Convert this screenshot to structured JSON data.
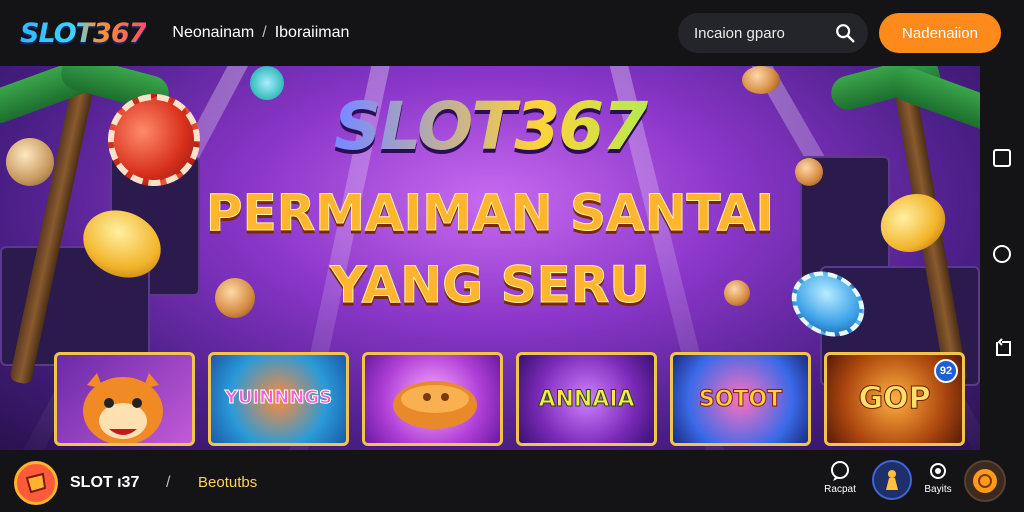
{
  "header": {
    "logo_text": "SLOT367",
    "nav_items": [
      "Neonainam",
      "Iboraiiman"
    ],
    "nav_separator": "/",
    "search_placeholder": "Incaion gparo",
    "cta_label": "Nadenaiion"
  },
  "banner": {
    "brand_title": "SLOT367",
    "headline_1": "PERMAIMAN SANTAI",
    "headline_2": "YANG SERU",
    "tiles": [
      {
        "label": "",
        "theme": "tiger"
      },
      {
        "label": "YUINNNGS",
        "theme": "blue"
      },
      {
        "label": "",
        "theme": "blob"
      },
      {
        "label": "ANNAIA",
        "theme": "purple"
      },
      {
        "label": "SOTOT",
        "theme": "blue-pink"
      },
      {
        "label": "GOP",
        "theme": "orange",
        "badge": "92"
      }
    ]
  },
  "rail": {
    "buttons": [
      "square-icon",
      "circle-icon",
      "back-icon"
    ]
  },
  "footer": {
    "brand": "SLOT ı37",
    "separator": "/",
    "link": "Beotutbs",
    "icons": [
      {
        "name": "chat-icon",
        "label": "Racpat"
      },
      {
        "name": "user-icon",
        "label": ""
      },
      {
        "name": "settings-icon",
        "label": "Bayits"
      }
    ]
  },
  "colors": {
    "accent": "#ff8a1c",
    "bar_bg": "#141416",
    "gold": "#f2c54a"
  }
}
